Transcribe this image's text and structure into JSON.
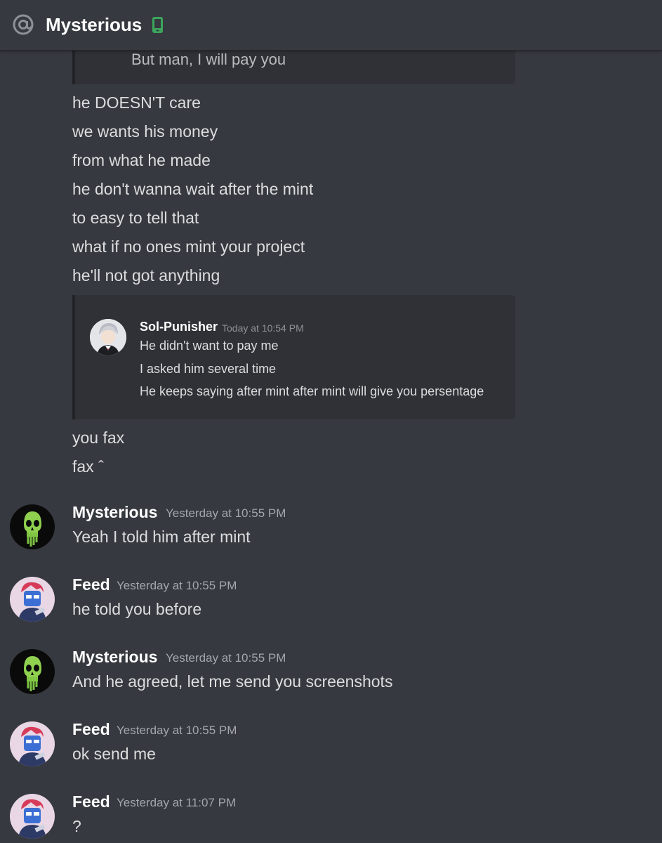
{
  "header": {
    "title": "Mysterious",
    "at_icon": "at-sign-icon",
    "status_icon": "mobile-phone-icon",
    "status_color": "#3ba55c"
  },
  "embed_top": {
    "cut_text": "But man, I will pay you"
  },
  "messages_continued": [
    "he DOESN'T care",
    "we wants his money",
    "from what he made",
    "he don't wanna wait after the mint",
    "to easy to tell that",
    "what if no ones mint your project",
    "he'll not got anything"
  ],
  "quote": {
    "author": "Sol-Punisher",
    "timestamp": "Today at 10:54 PM",
    "lines": [
      "He didn't want to pay me",
      "I asked him several time",
      "He keeps saying after mint after mint will give you persentage"
    ]
  },
  "messages_after_quote": [
    "you fax",
    "fax ˆ"
  ],
  "groups": [
    {
      "author": "Mysterious",
      "timestamp": "Yesterday at 10:55 PM",
      "text": "Yeah I told him after mint",
      "avatar": "green-skull-avatar"
    },
    {
      "author": "Feed",
      "timestamp": "Yesterday at 10:55 PM",
      "text": "he told you before",
      "avatar": "blue-robot-avatar"
    },
    {
      "author": "Mysterious",
      "timestamp": "Yesterday at 10:55 PM",
      "text": "And he agreed, let me send you screenshots",
      "avatar": "green-skull-avatar"
    },
    {
      "author": "Feed",
      "timestamp": "Yesterday at 10:55 PM",
      "text": "ok send me",
      "avatar": "blue-robot-avatar"
    },
    {
      "author": "Feed",
      "timestamp": "Yesterday at 11:07 PM",
      "text": "?",
      "avatar": "blue-robot-avatar"
    }
  ],
  "colors": {
    "background": "#36393f",
    "embed_background": "#2f3136",
    "text": "#dcddde",
    "author": "#ffffff",
    "timestamp": "#a3a6aa"
  }
}
